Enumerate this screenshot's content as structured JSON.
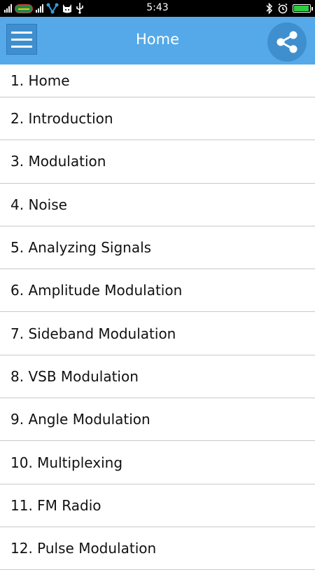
{
  "status_bar": {
    "time": "5:43",
    "icons": [
      "signal-icon",
      "carrier-icon",
      "signal-icon",
      "network-icon",
      "cat-icon",
      "usb-icon",
      "bluetooth-icon",
      "alarm-icon",
      "battery-icon"
    ]
  },
  "app_bar": {
    "title": "Home",
    "menu_icon": "hamburger-menu-icon",
    "share_icon": "share-icon",
    "accent": "#55a9e8"
  },
  "menu_items": [
    {
      "label": "1. Home"
    },
    {
      "label": "2. Introduction"
    },
    {
      "label": "3. Modulation"
    },
    {
      "label": "4. Noise"
    },
    {
      "label": "5. Analyzing Signals"
    },
    {
      "label": "6. Amplitude Modulation"
    },
    {
      "label": "7. Sideband Modulation"
    },
    {
      "label": "8. VSB Modulation"
    },
    {
      "label": "9. Angle Modulation"
    },
    {
      "label": "10. Multiplexing"
    },
    {
      "label": "11. FM Radio"
    },
    {
      "label": "12. Pulse Modulation"
    }
  ]
}
